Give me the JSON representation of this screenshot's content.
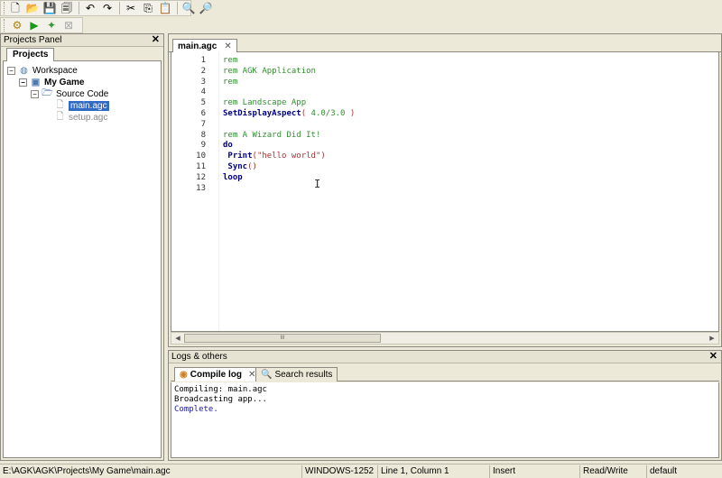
{
  "toolbar": {
    "main_buttons": [
      {
        "icon": "new-file-icon",
        "glyph": "🗋"
      },
      {
        "icon": "open-icon",
        "glyph": "📂"
      },
      {
        "icon": "save-icon",
        "glyph": "💾"
      },
      {
        "icon": "save-all-icon",
        "glyph": "🗐"
      },
      {
        "icon": "undo-icon",
        "glyph": "↶"
      },
      {
        "icon": "redo-icon",
        "glyph": "↷"
      },
      {
        "icon": "cut-icon",
        "glyph": "✂"
      },
      {
        "icon": "copy-icon",
        "glyph": "⎘"
      },
      {
        "icon": "paste-icon",
        "glyph": "📋"
      },
      {
        "icon": "find-icon",
        "glyph": "🔍"
      },
      {
        "icon": "replace-icon",
        "glyph": "🔎"
      }
    ],
    "build_buttons": [
      {
        "icon": "compile-icon",
        "glyph": "⚙"
      },
      {
        "icon": "run-icon",
        "glyph": "▶"
      },
      {
        "icon": "broadcast-icon",
        "glyph": "✦"
      },
      {
        "icon": "stop-icon",
        "glyph": "⊠"
      }
    ]
  },
  "projects_panel": {
    "title": "Projects Panel",
    "tab": "Projects",
    "tree": {
      "workspace": "Workspace",
      "project": "My Game",
      "folder": "Source Code",
      "files": [
        "main.agc",
        "setup.agc"
      ]
    }
  },
  "editor": {
    "tab_label": "main.agc",
    "line_numbers": [
      "1",
      "2",
      "3",
      "4",
      "5",
      "6",
      "7",
      "8",
      "9",
      "10",
      "11",
      "12",
      "13"
    ],
    "lines": [
      [
        {
          "t": "rem",
          "c": "green"
        }
      ],
      [
        {
          "t": "rem AGK Application",
          "c": "green"
        }
      ],
      [
        {
          "t": "rem",
          "c": "green"
        }
      ],
      [],
      [
        {
          "t": "rem Landscape App",
          "c": "green"
        }
      ],
      [
        {
          "t": "SetDisplayAspect",
          "c": "blue"
        },
        {
          "t": "( ",
          "c": "par"
        },
        {
          "t": "4.0/3.0",
          "c": "num"
        },
        {
          "t": " )",
          "c": "par"
        }
      ],
      [],
      [
        {
          "t": "rem A Wizard Did It!",
          "c": "green"
        }
      ],
      [
        {
          "t": "do",
          "c": "blue"
        }
      ],
      [
        {
          "t": " Print",
          "c": "blue"
        },
        {
          "t": "(",
          "c": "par"
        },
        {
          "t": "\"hello world\"",
          "c": "str"
        },
        {
          "t": ")",
          "c": "par"
        }
      ],
      [
        {
          "t": " Sync",
          "c": "blue"
        },
        {
          "t": "()",
          "c": "par"
        }
      ],
      [
        {
          "t": "loop",
          "c": "blue"
        }
      ],
      []
    ],
    "scroll_thumb_label": "III"
  },
  "logs_panel": {
    "title": "Logs & others",
    "tabs": [
      {
        "label": "Compile log",
        "icon": "compile-log-icon",
        "active": true
      },
      {
        "label": "Search results",
        "icon": "search-results-icon",
        "active": false
      }
    ],
    "log_lines": [
      {
        "text": "Compiling: main.agc",
        "color": "#000000"
      },
      {
        "text": "Broadcasting app...",
        "color": "#000000"
      },
      {
        "text": "Complete.",
        "color": "#1a1ab0"
      }
    ]
  },
  "statusbar": {
    "path": "E:\\AGK\\AGK\\Projects\\My Game\\main.agc",
    "encoding": "WINDOWS-1252",
    "position": "Line 1, Column 1",
    "mode": "Insert",
    "access": "Read/Write",
    "profile": "default"
  }
}
